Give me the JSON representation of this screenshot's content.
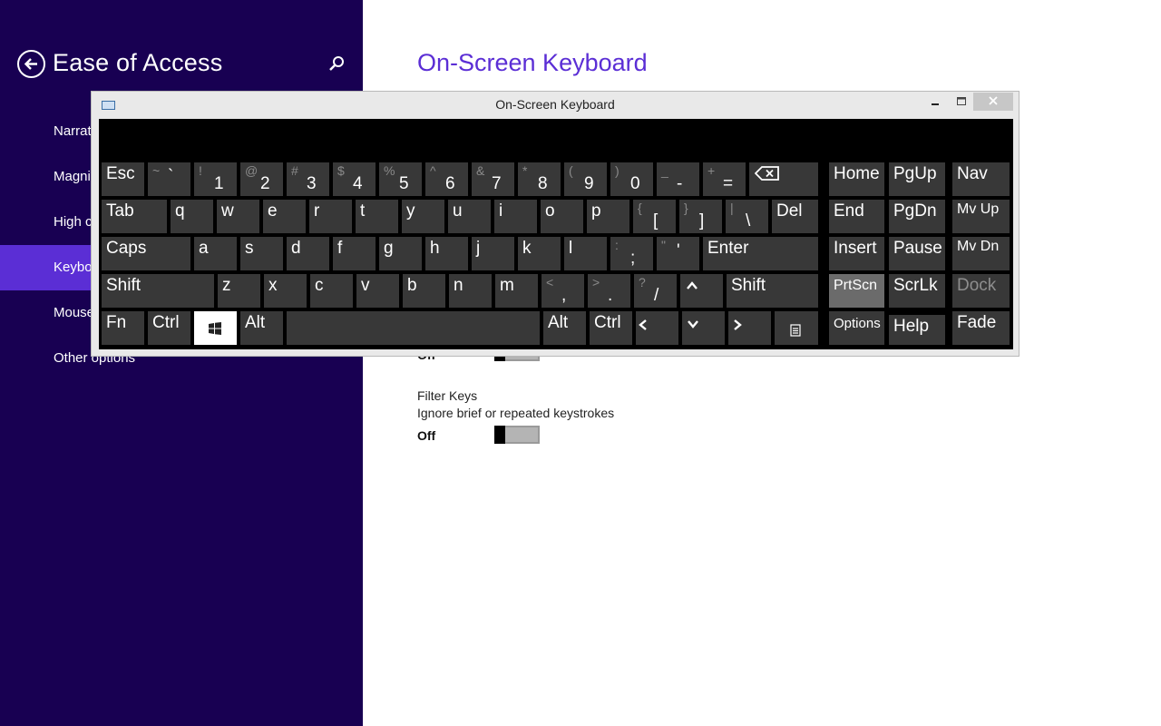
{
  "sidebar": {
    "title": "Ease of Access",
    "items": [
      {
        "label": "Narrator"
      },
      {
        "label": "Magnifier"
      },
      {
        "label": "High contrast"
      },
      {
        "label": "Keyboard"
      },
      {
        "label": "Mouse"
      },
      {
        "label": "Other options"
      }
    ]
  },
  "main": {
    "title": "On-Screen Keyboard",
    "hidden_toggle_state": "Off",
    "filter_keys": {
      "title": "Filter Keys",
      "description": "Ignore brief or repeated keystrokes",
      "state": "Off"
    }
  },
  "osk": {
    "title": "On-Screen Keyboard",
    "row1": [
      {
        "label": "Esc"
      },
      {
        "shift": "~",
        "base": "`"
      },
      {
        "shift": "!",
        "base": "1"
      },
      {
        "shift": "@",
        "base": "2"
      },
      {
        "shift": "#",
        "base": "3"
      },
      {
        "shift": "$",
        "base": "4"
      },
      {
        "shift": "%",
        "base": "5"
      },
      {
        "shift": "^",
        "base": "6"
      },
      {
        "shift": "&",
        "base": "7"
      },
      {
        "shift": "*",
        "base": "8"
      },
      {
        "shift": "(",
        "base": "9"
      },
      {
        "shift": ")",
        "base": "0"
      },
      {
        "shift": "_",
        "base": "-"
      },
      {
        "shift": "+",
        "base": "="
      }
    ],
    "row2": [
      {
        "label": "Tab"
      },
      {
        "label": "q"
      },
      {
        "label": "w"
      },
      {
        "label": "e"
      },
      {
        "label": "r"
      },
      {
        "label": "t"
      },
      {
        "label": "y"
      },
      {
        "label": "u"
      },
      {
        "label": "i"
      },
      {
        "label": "o"
      },
      {
        "label": "p"
      },
      {
        "shift": "{",
        "base": "["
      },
      {
        "shift": "}",
        "base": "]"
      },
      {
        "shift": "|",
        "base": "\\"
      },
      {
        "label": "Del"
      }
    ],
    "row3": [
      {
        "label": "Caps"
      },
      {
        "label": "a"
      },
      {
        "label": "s"
      },
      {
        "label": "d"
      },
      {
        "label": "f"
      },
      {
        "label": "g"
      },
      {
        "label": "h"
      },
      {
        "label": "j"
      },
      {
        "label": "k"
      },
      {
        "label": "l"
      },
      {
        "shift": ":",
        "base": ";"
      },
      {
        "shift": "\"",
        "base": "'"
      },
      {
        "label": "Enter"
      }
    ],
    "row4": [
      {
        "label": "Shift"
      },
      {
        "label": "z"
      },
      {
        "label": "x"
      },
      {
        "label": "c"
      },
      {
        "label": "v"
      },
      {
        "label": "b"
      },
      {
        "label": "n"
      },
      {
        "label": "m"
      },
      {
        "shift": "<",
        "base": ","
      },
      {
        "shift": ">",
        "base": "."
      },
      {
        "shift": "?",
        "base": "/"
      },
      {
        "label": "Shift"
      }
    ],
    "row5": [
      {
        "label": "Fn"
      },
      {
        "label": "Ctrl"
      },
      {
        "label": "Alt"
      },
      {
        "label": "Alt"
      },
      {
        "label": "Ctrl"
      }
    ],
    "nav": {
      "home": "Home",
      "pgup": "PgUp",
      "nav": "Nav",
      "end": "End",
      "pgdn": "PgDn",
      "mvup": "Mv Up",
      "insert": "Insert",
      "pause": "Pause",
      "mvdn": "Mv Dn",
      "prtscn": "PrtScn",
      "scrlk": "ScrLk",
      "dock": "Dock",
      "options": "Options",
      "help": "Help",
      "fade": "Fade"
    }
  },
  "colors": {
    "sidebar_bg": "#180052",
    "accent": "#5b2ed5",
    "key_bg": "#383838",
    "keyboard_bg": "#000000"
  }
}
